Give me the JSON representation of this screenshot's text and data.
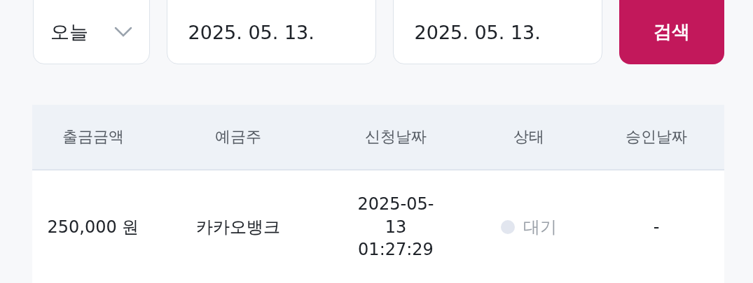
{
  "filter": {
    "period": "오늘",
    "start_date": "2025. 05. 13.",
    "end_date": "2025. 05. 13.",
    "search_button": "검색"
  },
  "table": {
    "columns": [
      "출금금액",
      "예금주",
      "신청날짜",
      "상태",
      "승인날짜"
    ],
    "rows": [
      {
        "amount": "250,000 원",
        "holder": "카카오뱅크",
        "requested": "2025-05-13 01:27:29",
        "status": {
          "label": "대기",
          "color": "#e2e6ef"
        },
        "approved": "-"
      }
    ]
  }
}
